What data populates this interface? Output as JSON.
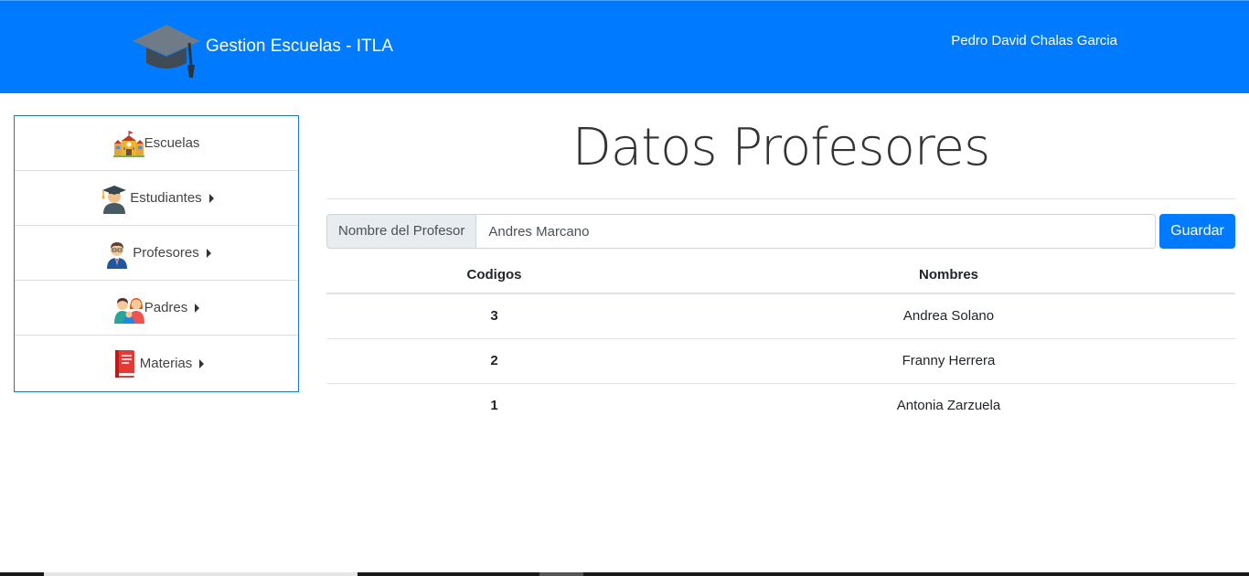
{
  "header": {
    "brand_title": "Gestion Escuelas - ITLA",
    "brand_icon": "graduation-cap-icon",
    "user_name": "Pedro David Chalas Garcia"
  },
  "sidebar": {
    "items": [
      {
        "label": "Escuelas",
        "icon": "school-building-icon",
        "has_submenu": false
      },
      {
        "label": "Estudiantes",
        "icon": "student-graduate-icon",
        "has_submenu": true
      },
      {
        "label": "Profesores",
        "icon": "teacher-icon",
        "has_submenu": true
      },
      {
        "label": "Padres",
        "icon": "parents-icon",
        "has_submenu": true
      },
      {
        "label": "Materias",
        "icon": "book-icon",
        "has_submenu": true
      }
    ]
  },
  "main": {
    "title": "Datos Profesores",
    "form": {
      "label": "Nombre del Profesor",
      "value": "Andres Marcano",
      "save_label": "Guardar"
    },
    "table": {
      "headers": [
        "Codigos",
        "Nombres"
      ],
      "rows": [
        {
          "code": "3",
          "name": "Andrea Solano"
        },
        {
          "code": "2",
          "name": "Franny Herrera"
        },
        {
          "code": "1",
          "name": "Antonia Zarzuela"
        }
      ]
    }
  },
  "colors": {
    "primary": "#007bff",
    "sidebar_border": "#1877d9"
  }
}
